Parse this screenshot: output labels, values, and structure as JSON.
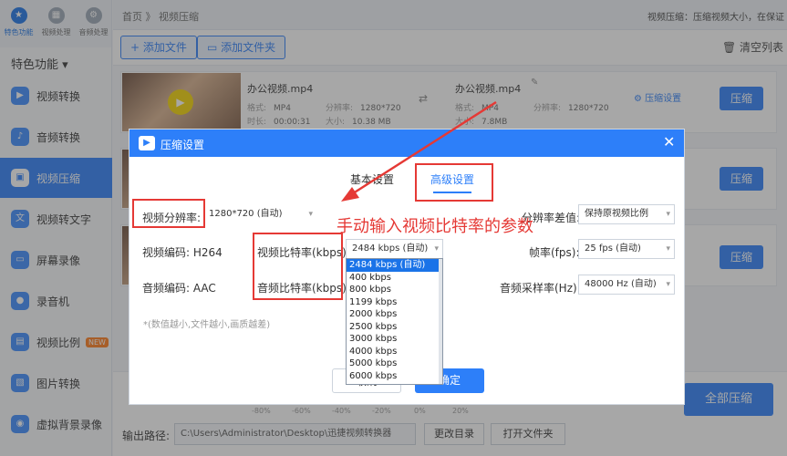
{
  "app": {
    "top_nav": [
      {
        "label": "特色功能",
        "icon": "star-icon",
        "glyph": "★"
      },
      {
        "label": "视频处理",
        "icon": "film-icon",
        "glyph": "▦"
      },
      {
        "label": "音频处理",
        "icon": "gear-icon",
        "glyph": "⚙"
      }
    ],
    "sidebar": {
      "header": "特色功能 ▾",
      "items": [
        {
          "label": "视频转换",
          "glyph": "▶"
        },
        {
          "label": "音频转换",
          "glyph": "♪"
        },
        {
          "label": "视频压缩",
          "glyph": "▣"
        },
        {
          "label": "视频转文字",
          "glyph": "文"
        },
        {
          "label": "屏幕录像",
          "glyph": "▭"
        },
        {
          "label": "录音机",
          "glyph": "●"
        },
        {
          "label": "视频比例",
          "glyph": "▤",
          "badge": "NEW"
        },
        {
          "label": "图片转换",
          "glyph": "▧"
        },
        {
          "label": "虚拟背景录像",
          "glyph": "◉"
        }
      ]
    },
    "header": {
      "breadcrumb": "首页 》 视频压缩",
      "note": "视频压缩：压缩视频大小，在保证"
    },
    "toolbar": {
      "add_file": "+ 添加文件",
      "add_folder": "▭ 添加文件夹",
      "clear_list": "🗑 清空列表"
    },
    "file": {
      "name": "办公视频.mp4",
      "format_label": "格式:",
      "format": "MP4",
      "resolution_label": "分辨率:",
      "resolution": "1280*720",
      "duration_label": "时长:",
      "duration": "00:00:31",
      "size_label": "大小:",
      "size": "10.38 MB",
      "out_name": "办公视频.mp4",
      "out_format": "MP4",
      "out_resolution": "1280*720",
      "out_size": "7.8MB",
      "settings_label": "压缩设置",
      "compress_label": "压缩"
    },
    "bottom": {
      "output_label": "输出路径:",
      "output_path": "C:\\Users\\Administrator\\Desktop\\迅捷视频转换器",
      "change_dir": "更改目录",
      "open_folder": "打开文件夹",
      "compress_all": "全部压缩",
      "pcts": [
        "-80%",
        "-60%",
        "-40%",
        "-20%",
        "0%",
        "20%"
      ]
    },
    "modal": {
      "title": "压缩设置",
      "tab_basic": "基本设置",
      "tab_advanced": "高级设置",
      "video_res_label": "视频分辨率:",
      "video_res_value": "1280*720 (自动)",
      "res_diff_label": "分辨率差值:",
      "res_diff_value": "保持原视频比例",
      "video_codec_label": "视频编码: H264",
      "video_bitrate_label": "视频比特率(kbps):",
      "video_bitrate_value": "2484 kbps (自动)",
      "fps_label": "帧率(fps):",
      "fps_value": "25 fps (自动)",
      "audio_codec_label": "音频编码: AAC",
      "audio_bitrate_label": "音频比特率(kbps):",
      "sample_rate_label": "音频采样率(Hz):",
      "sample_rate_value": "48000 Hz (自动)",
      "note": "*(数值越小,文件越小,画质越差)",
      "cancel": "取消",
      "ok": "确定",
      "bitrate_options": [
        "2484 kbps (自动)",
        "400 kbps",
        "800 kbps",
        "1199 kbps",
        "2000 kbps",
        "2500 kbps",
        "3000 kbps",
        "4000 kbps",
        "5000 kbps",
        "6000 kbps"
      ]
    },
    "annotation": "手动输入视频比特率的参数",
    "colors": {
      "accent": "#2d7ff9",
      "annotation_red": "#e53935"
    }
  }
}
